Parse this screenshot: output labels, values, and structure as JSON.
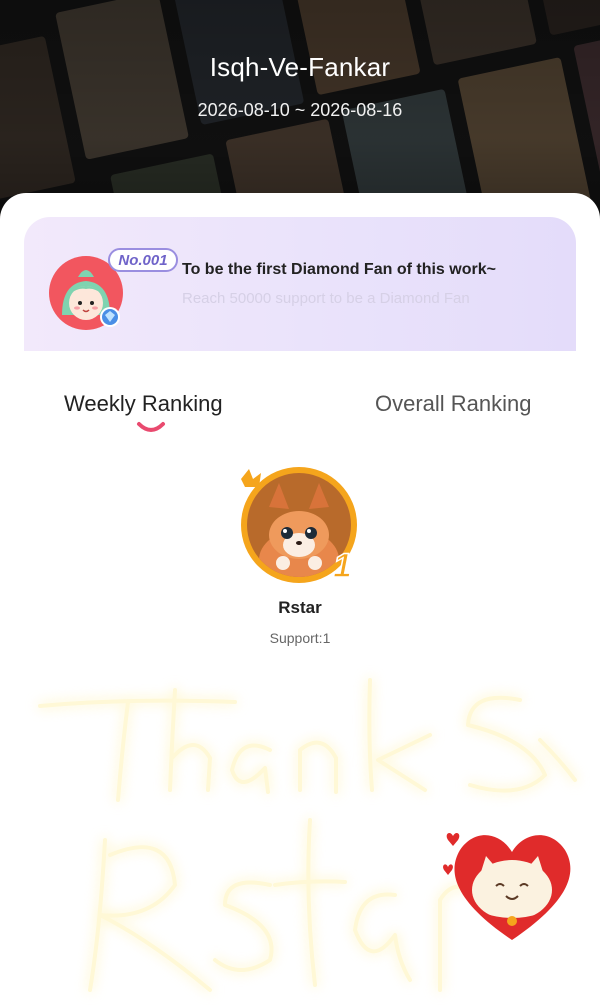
{
  "header": {
    "title": "Isqh-Ve-Fankar",
    "date_range": "2026-08-10 ~ 2026-08-16"
  },
  "diamond_card": {
    "badge": "No.001",
    "title": "To be the first Diamond Fan of this work~",
    "subtitle": "Reach 50000 support to be a Diamond Fan"
  },
  "tabs": [
    {
      "label": "Weekly Ranking",
      "active": true
    },
    {
      "label": "Overall Ranking",
      "active": false
    }
  ],
  "top_fan": {
    "rank": "1",
    "name": "Rstar",
    "support": "Support:1"
  },
  "overlay": {
    "handwritten_text": "Thanks Rstar"
  },
  "colors": {
    "accent": "#e94a6f",
    "badge": "#6f63c9",
    "gold": "#f5a51c",
    "glow": "#ffcf3d"
  }
}
